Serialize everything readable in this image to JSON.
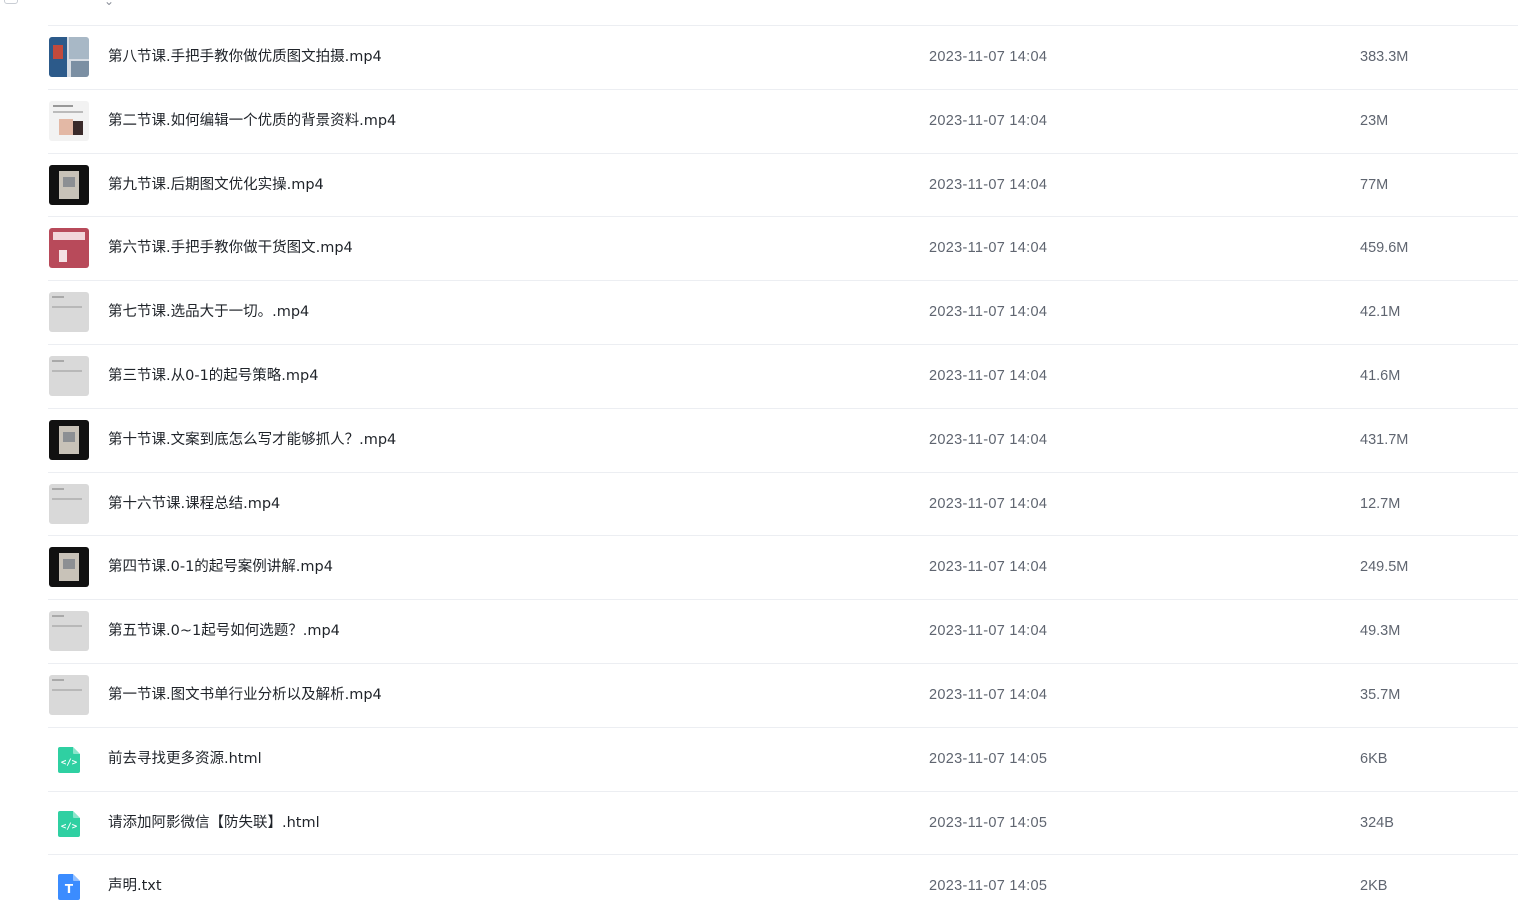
{
  "colors": {
    "html_icon": "#2fd0a2",
    "txt_icon": "#3b8cff",
    "divider": "#eceef2",
    "meta_text": "#5f6570"
  },
  "files": [
    {
      "name": "第八节课.手把手教你做优质图文拍摄.mp4",
      "date": "2023-11-07 14:04",
      "size": "383.3M",
      "kind": "video",
      "thumb": "photo-blue"
    },
    {
      "name": "第二节课.如何编辑一个优质的背景资料.mp4",
      "date": "2023-11-07 14:04",
      "size": "23M",
      "kind": "video",
      "thumb": "doc-person"
    },
    {
      "name": "第九节课.后期图文优化实操.mp4",
      "date": "2023-11-07 14:04",
      "size": "77M",
      "kind": "video",
      "thumb": "dark-phone"
    },
    {
      "name": "第六节课.手把手教你做干货图文.mp4",
      "date": "2023-11-07 14:04",
      "size": "459.6M",
      "kind": "video",
      "thumb": "red-poster"
    },
    {
      "name": "第七节课.选品大于一切。.mp4",
      "date": "2023-11-07 14:04",
      "size": "42.1M",
      "kind": "video",
      "thumb": "grey-doc"
    },
    {
      "name": "第三节课.从0-1的起号策略.mp4",
      "date": "2023-11-07 14:04",
      "size": "41.6M",
      "kind": "video",
      "thumb": "grey-doc"
    },
    {
      "name": "第十节课.文案到底怎么写才能够抓人？.mp4",
      "date": "2023-11-07 14:04",
      "size": "431.7M",
      "kind": "video",
      "thumb": "dark-phone"
    },
    {
      "name": "第十六节课.课程总结.mp4",
      "date": "2023-11-07 14:04",
      "size": "12.7M",
      "kind": "video",
      "thumb": "grey-doc"
    },
    {
      "name": "第四节课.0-1的起号案例讲解.mp4",
      "date": "2023-11-07 14:04",
      "size": "249.5M",
      "kind": "video",
      "thumb": "dark-phone"
    },
    {
      "name": "第五节课.0~1起号如何选题？.mp4",
      "date": "2023-11-07 14:04",
      "size": "49.3M",
      "kind": "video",
      "thumb": "grey-doc"
    },
    {
      "name": "第一节课.图文书单行业分析以及解析.mp4",
      "date": "2023-11-07 14:04",
      "size": "35.7M",
      "kind": "video",
      "thumb": "grey-doc"
    },
    {
      "name": "前去寻找更多资源.html",
      "date": "2023-11-07 14:05",
      "size": "6KB",
      "kind": "html",
      "thumb": "code-file-icon"
    },
    {
      "name": "请添加阿影微信【防失联】.html",
      "date": "2023-11-07 14:05",
      "size": "324B",
      "kind": "html",
      "thumb": "code-file-icon"
    },
    {
      "name": "声明.txt",
      "date": "2023-11-07 14:05",
      "size": "2KB",
      "kind": "txt",
      "thumb": "text-file-icon"
    }
  ]
}
